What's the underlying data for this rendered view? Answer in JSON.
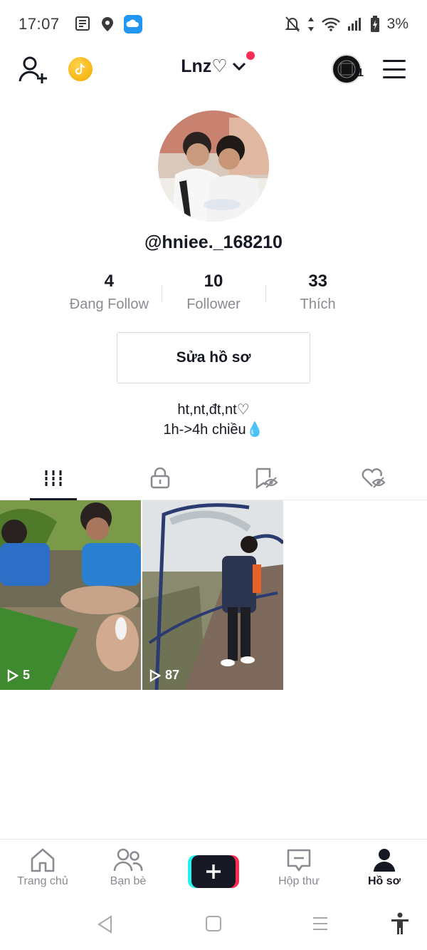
{
  "status_bar": {
    "time": "17:07",
    "battery": "3%",
    "icons": [
      "news-icon",
      "location-icon",
      "cloud-app-icon",
      "mute-icon",
      "data-arrows-icon",
      "wifi-icon",
      "signal-icon",
      "battery-charging-icon"
    ]
  },
  "header": {
    "username": "Lnz♡",
    "story_count": "1",
    "icons": [
      "add-user-icon",
      "coin-icon",
      "chevron-down-icon",
      "menu-icon"
    ]
  },
  "profile": {
    "handle": "@hniee._168210",
    "stats": [
      {
        "value": "4",
        "label": "Đang Follow"
      },
      {
        "value": "10",
        "label": "Follower"
      },
      {
        "value": "33",
        "label": "Thích"
      }
    ],
    "edit_button": "Sửa hồ sơ",
    "bio_line1": "ht,nt,đt,nt♡",
    "bio_line2": "1h->4h chiều💧"
  },
  "tabs": [
    {
      "icon": "grid-icon",
      "active": true
    },
    {
      "icon": "lock-icon",
      "active": false
    },
    {
      "icon": "saved-hidden-icon",
      "active": false
    },
    {
      "icon": "liked-hidden-icon",
      "active": false
    }
  ],
  "videos": [
    {
      "views": "5"
    },
    {
      "views": "87"
    }
  ],
  "bottom_nav": [
    {
      "label": "Trang chủ",
      "icon": "home-icon"
    },
    {
      "label": "Bạn bè",
      "icon": "friends-icon"
    },
    {
      "label": "",
      "icon": "plus-icon"
    },
    {
      "label": "Hộp thư",
      "icon": "inbox-icon"
    },
    {
      "label": "Hồ sơ",
      "icon": "profile-icon"
    }
  ],
  "colors": {
    "accent_red": "#fe2c55",
    "accent_cyan": "#25f4ee",
    "text_primary": "#161823",
    "text_secondary": "#8a8b91"
  }
}
